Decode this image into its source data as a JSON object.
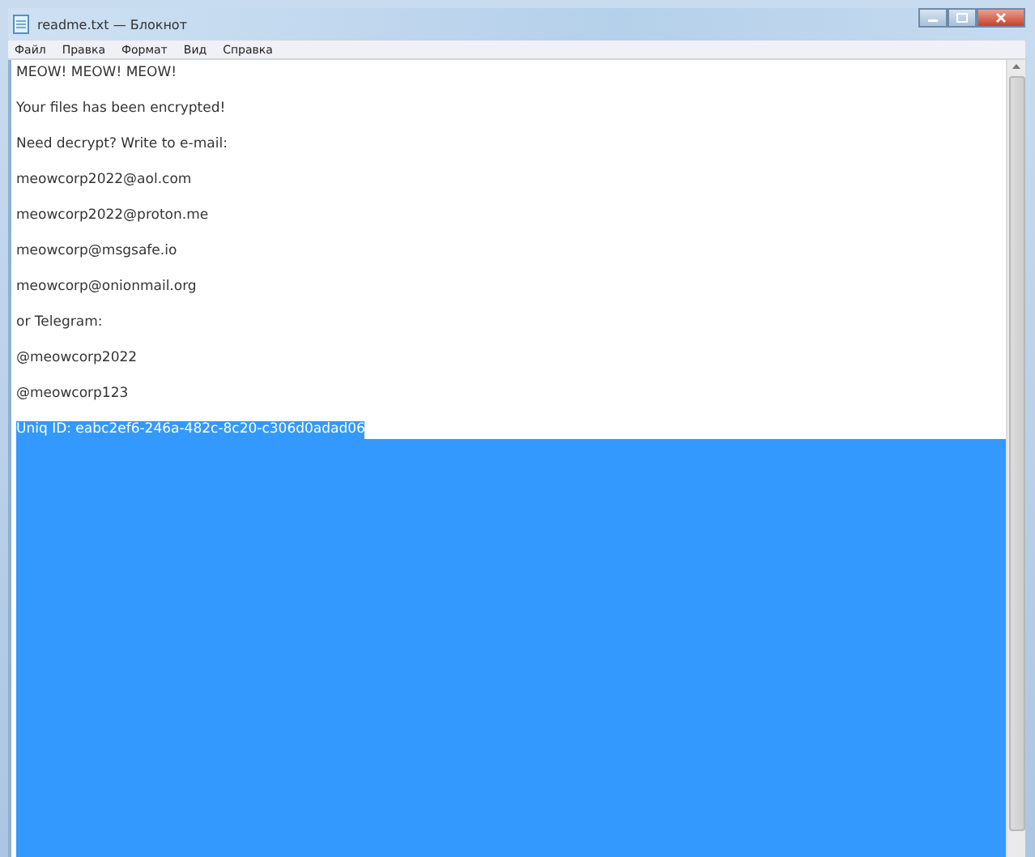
{
  "window": {
    "title": "readme.txt — Блокнот"
  },
  "menu": [
    "Файл",
    "Правка",
    "Формат",
    "Вид",
    "Справка"
  ],
  "editor": {
    "lines": [
      {
        "text": "MEOW! MEOW! MEOW!",
        "selected": false
      },
      {
        "text": "Your files has been encrypted!",
        "selected": false
      },
      {
        "text": "Need decrypt?  Write to e-mail:",
        "selected": false
      },
      {
        "text": "meowcorp2022@aol.com",
        "selected": false
      },
      {
        "text": "meowcorp2022@proton.me",
        "selected": false
      },
      {
        "text": "meowcorp@msgsafe.io",
        "selected": false
      },
      {
        "text": "meowcorp@onionmail.org",
        "selected": false
      },
      {
        "text": "or Telegram:",
        "selected": false
      },
      {
        "text": "@meowcorp2022",
        "selected": false
      },
      {
        "text": "@meowcorp123",
        "selected": false
      },
      {
        "text": "Uniq ID: eabc2ef6-246a-482c-8c20-c306d0adad06",
        "selected": true
      }
    ],
    "trailing_selection": true
  }
}
